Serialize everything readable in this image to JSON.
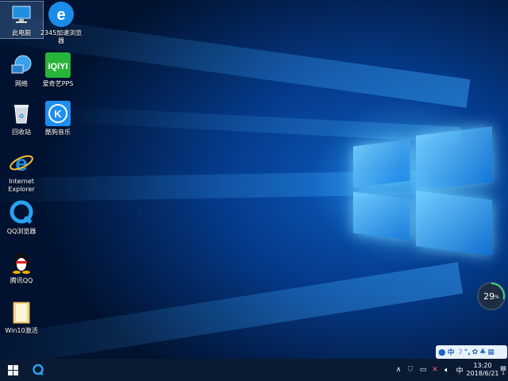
{
  "desktop": {
    "icons": [
      {
        "label": "此电脑",
        "icon": "this-pc-icon"
      },
      {
        "label": "2345加速浏览器",
        "icon": "2345-browser-icon"
      },
      {
        "label": "网络",
        "icon": "network-icon"
      },
      {
        "label": "爱奇艺PPS",
        "icon": "iqiyi-icon"
      },
      {
        "label": "回收站",
        "icon": "recycle-bin-icon"
      },
      {
        "label": "酷狗音乐",
        "icon": "kugou-music-icon"
      },
      {
        "label": "Internet Explorer",
        "icon": "ie-icon"
      },
      {
        "label": "QQ浏览器",
        "icon": "qq-browser-icon"
      },
      {
        "label": "腾讯QQ",
        "icon": "qq-icon"
      },
      {
        "label": "Win10激活",
        "icon": "folder-icon"
      }
    ]
  },
  "gauge": {
    "value": "29",
    "unit": "%"
  },
  "ime": {
    "lang": "中"
  },
  "taskbar": {
    "time": "13:20",
    "date": "2018/6/21",
    "notification_count": "1"
  },
  "colors": {
    "taskbar": "#0a1a33",
    "wallpaper": "#053b8c",
    "logo": "#4fc3ff"
  }
}
